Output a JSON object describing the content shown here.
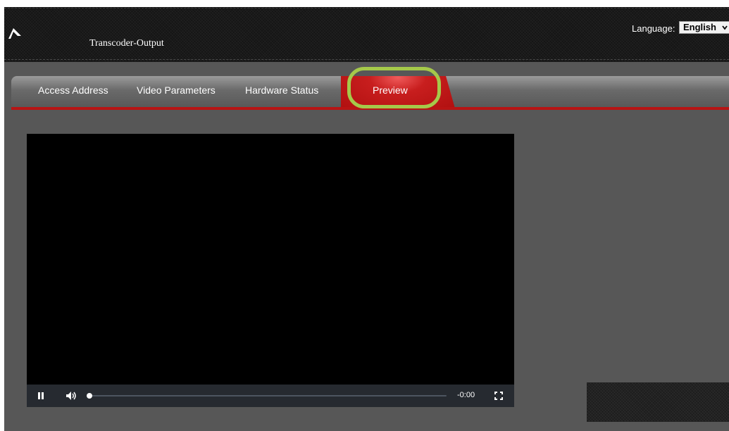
{
  "header": {
    "app_title": "Transcoder-Output",
    "language_label": "Language:",
    "language_selected": "English"
  },
  "tabs": [
    {
      "label": "Access Address"
    },
    {
      "label": "Video Parameters"
    },
    {
      "label": "Hardware Status"
    },
    {
      "label": "Preview",
      "active": true
    }
  ],
  "player": {
    "time_remaining": "-0:00",
    "progress": 0
  },
  "colors": {
    "accent_red": "#b81414",
    "highlight_green": "#a5c94a",
    "panel_gray": "#575757"
  },
  "icons": [
    "logo-icon",
    "chevron-down-icon",
    "pause-icon",
    "volume-icon",
    "fullscreen-icon"
  ]
}
